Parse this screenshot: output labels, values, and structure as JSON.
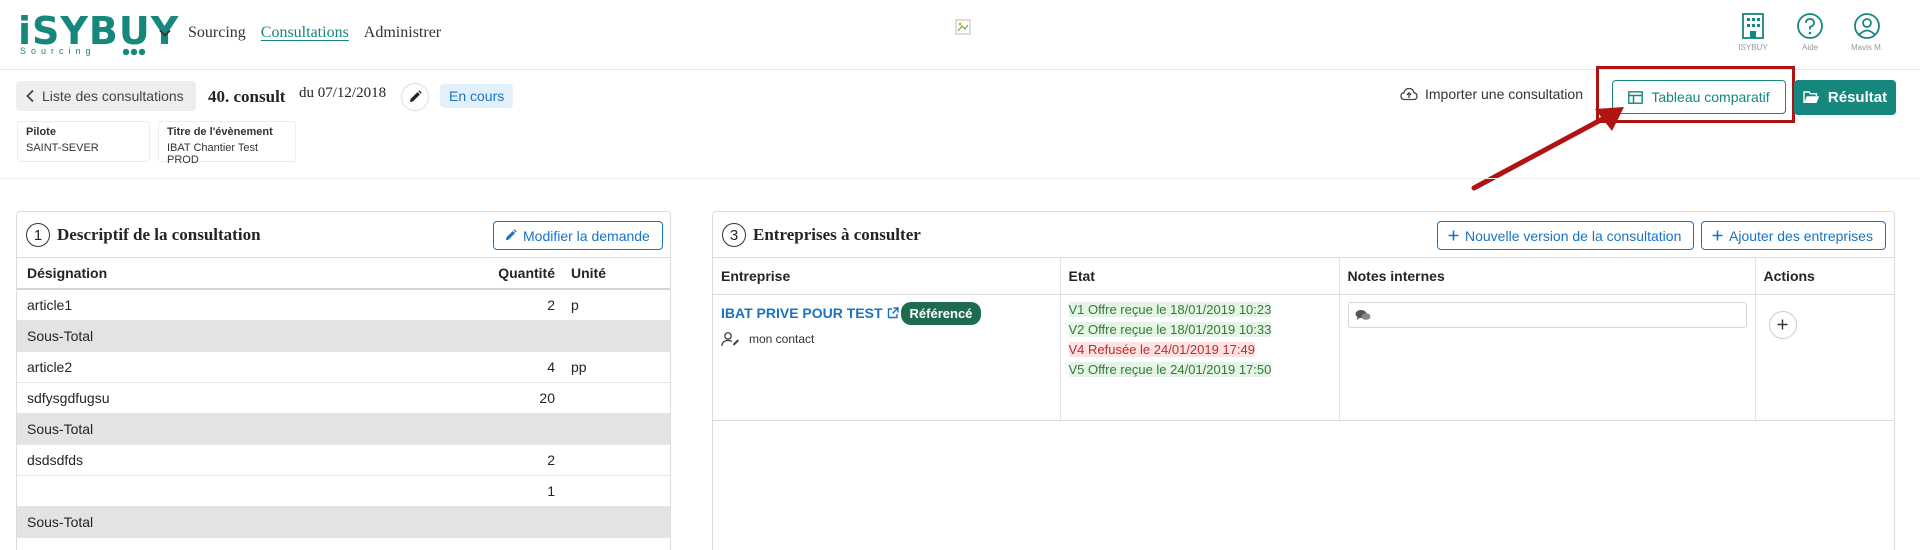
{
  "app": {
    "logo_text": "iSYBUY",
    "logo_sub": "Sourcing",
    "nav": [
      "Sourcing",
      "Consultations",
      "Administrer"
    ],
    "active_nav": "Consultations",
    "top_icons": [
      {
        "icon": "building-icon",
        "caption": "ISYBUY"
      },
      {
        "icon": "help-icon",
        "caption": "Aide"
      },
      {
        "icon": "user-icon",
        "caption": "Mavis M."
      }
    ]
  },
  "consultation": {
    "back_label": "Liste des consultations",
    "title": "40. consult",
    "date_text": "du 07/12/2018",
    "status": "En cours",
    "info": [
      {
        "label": "Pilote",
        "value": "SAINT-SEVER"
      },
      {
        "label": "Titre de l'évènement",
        "value": "IBAT Chantier Test PROD"
      }
    ]
  },
  "actions": {
    "import_label": "Importer une consultation",
    "tableau_label": "Tableau comparatif",
    "resultat_label": "Résultat"
  },
  "descriptif": {
    "step": "1",
    "title": "Descriptif de la consultation",
    "edit_label": "Modifier la demande",
    "columns": [
      "Désignation",
      "Quantité",
      "Unité"
    ],
    "rows": [
      {
        "designation": "article1",
        "quantite": "2",
        "unite": "p",
        "subtotal": false
      },
      {
        "designation": "Sous-Total",
        "quantite": "",
        "unite": "",
        "subtotal": true
      },
      {
        "designation": "article2",
        "quantite": "4",
        "unite": "pp",
        "subtotal": false
      },
      {
        "designation": "sdfysgdfugsu",
        "quantite": "20",
        "unite": "",
        "subtotal": false
      },
      {
        "designation": "Sous-Total",
        "quantite": "",
        "unite": "",
        "subtotal": true
      },
      {
        "designation": "dsdsdfds",
        "quantite": "2",
        "unite": "",
        "subtotal": false
      },
      {
        "designation": "",
        "quantite": "1",
        "unite": "",
        "subtotal": false
      },
      {
        "designation": "Sous-Total",
        "quantite": "",
        "unite": "",
        "subtotal": true
      }
    ]
  },
  "entreprises": {
    "step": "3",
    "title": "Entreprises à consulter",
    "new_version_label": "Nouvelle version de la consultation",
    "add_label": "Ajouter des entreprises",
    "columns": [
      "Entreprise",
      "Etat",
      "Notes internes",
      "Actions"
    ],
    "rows": [
      {
        "name": "IBAT PRIVE POUR TEST",
        "badge": "Référencé",
        "contact": "mon contact",
        "states": [
          {
            "text": "V1 Offre reçue le 18/01/2019 10:23",
            "kind": "ok"
          },
          {
            "text": "V2 Offre reçue le 18/01/2019 10:33",
            "kind": "ok"
          },
          {
            "text": "V4 Refusée le 24/01/2019 17:49",
            "kind": "ko"
          },
          {
            "text": "V5 Offre reçue le 24/01/2019 17:50",
            "kind": "ok"
          }
        ]
      }
    ]
  },
  "colors": {
    "brand": "#16877d",
    "link": "#1a73c4",
    "badge": "#1e6b4f",
    "highlight": "#b11212"
  }
}
